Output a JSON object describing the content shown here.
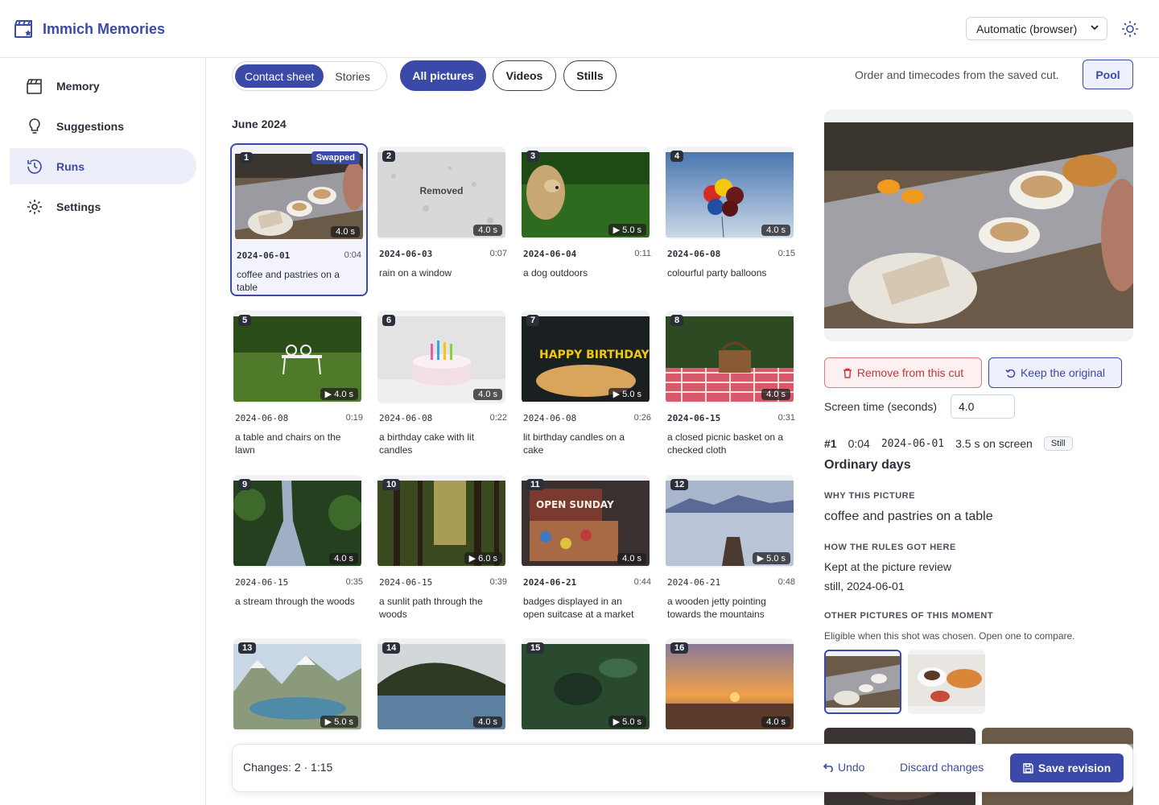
{
  "app": {
    "title": "Immich Memories"
  },
  "header": {
    "theme_select": "Automatic (browser)"
  },
  "sidebar": {
    "items": [
      {
        "label": "Memory",
        "icon": "clapperboard-icon"
      },
      {
        "label": "Suggestions",
        "icon": "lightbulb-icon"
      },
      {
        "label": "Runs",
        "icon": "history-icon",
        "active": true
      },
      {
        "label": "Settings",
        "icon": "gear-icon"
      }
    ]
  },
  "toolbar": {
    "view_tabs": [
      "Contact sheet",
      "Stories"
    ],
    "filters": [
      "All pictures",
      "Videos",
      "Stills"
    ],
    "order_note": "Order and timecodes from the saved cut.",
    "pool_label": "Pool"
  },
  "month": "June 2024",
  "cards": [
    {
      "n": "1",
      "date": "2024-06-01",
      "tc": "0:04",
      "caption": "coffee and pastries on a table",
      "dur": "4.0 s",
      "badge": "Swapped"
    },
    {
      "n": "2",
      "date": "2024-06-03",
      "tc": "0:07",
      "caption": "rain on a window",
      "dur": "4.0 s",
      "overlay": "Removed"
    },
    {
      "n": "3",
      "date": "2024-06-04",
      "tc": "0:11",
      "caption": "a dog outdoors",
      "dur": "▶ 5.0 s"
    },
    {
      "n": "4",
      "date": "2024-06-08",
      "tc": "0:15",
      "caption": "colourful party balloons",
      "dur": "4.0 s"
    },
    {
      "n": "5",
      "date": "2024-06-08",
      "tc": "0:19",
      "caption": "a table and chairs on the lawn",
      "dur": "▶ 4.0 s"
    },
    {
      "n": "6",
      "date": "2024-06-08",
      "tc": "0:22",
      "caption": "a birthday cake with lit candles",
      "dur": "4.0 s"
    },
    {
      "n": "7",
      "date": "2024-06-08",
      "tc": "0:26",
      "caption": "lit birthday candles on a cake",
      "dur": "▶ 5.0 s"
    },
    {
      "n": "8",
      "date": "2024-06-15",
      "tc": "0:31",
      "caption": "a closed picnic basket on a checked cloth",
      "dur": "4.0 s"
    },
    {
      "n": "9",
      "date": "2024-06-15",
      "tc": "0:35",
      "caption": "a stream through the woods",
      "dur": "4.0 s"
    },
    {
      "n": "10",
      "date": "2024-06-15",
      "tc": "0:39",
      "caption": "a sunlit path through the woods",
      "dur": "▶ 6.0 s"
    },
    {
      "n": "11",
      "date": "2024-06-21",
      "tc": "0:44",
      "caption": "badges displayed in an open suitcase at a market",
      "dur": "4.0 s"
    },
    {
      "n": "12",
      "date": "2024-06-21",
      "tc": "0:48",
      "caption": "a wooden jetty pointing towards the mountains",
      "dur": "▶ 5.0 s"
    },
    {
      "n": "13",
      "dur": "▶ 5.0 s"
    },
    {
      "n": "14",
      "dur": "4.0 s"
    },
    {
      "n": "15",
      "dur": "▶ 5.0 s"
    },
    {
      "n": "16",
      "dur": "4.0 s"
    }
  ],
  "detail": {
    "remove_label": "Remove from this cut",
    "keep_label": "Keep the original",
    "screen_time_label": "Screen time (seconds)",
    "screen_time_value": "4.0",
    "index": "#1",
    "timecode": "0:04",
    "date": "2024-06-01",
    "on_screen": "3.5 s on screen",
    "kind": "Still",
    "moment": "Ordinary days",
    "why_heading": "WHY THIS PICTURE",
    "why_value": "coffee and pastries on a table",
    "how_heading": "HOW THE RULES GOT HERE",
    "how_line1": "Kept at the picture review",
    "how_line2": "still, 2024-06-01",
    "other_heading": "OTHER PICTURES OF THIS MOMENT",
    "other_note": "Eligible when this shot was chosen. Open one to compare."
  },
  "footer": {
    "changes": "Changes: 2 · 1:15",
    "undo": "Undo",
    "discard": "Discard changes",
    "save": "Save revision"
  },
  "colors": {
    "accent": "#3b4aa8",
    "danger": "#c8343b"
  }
}
